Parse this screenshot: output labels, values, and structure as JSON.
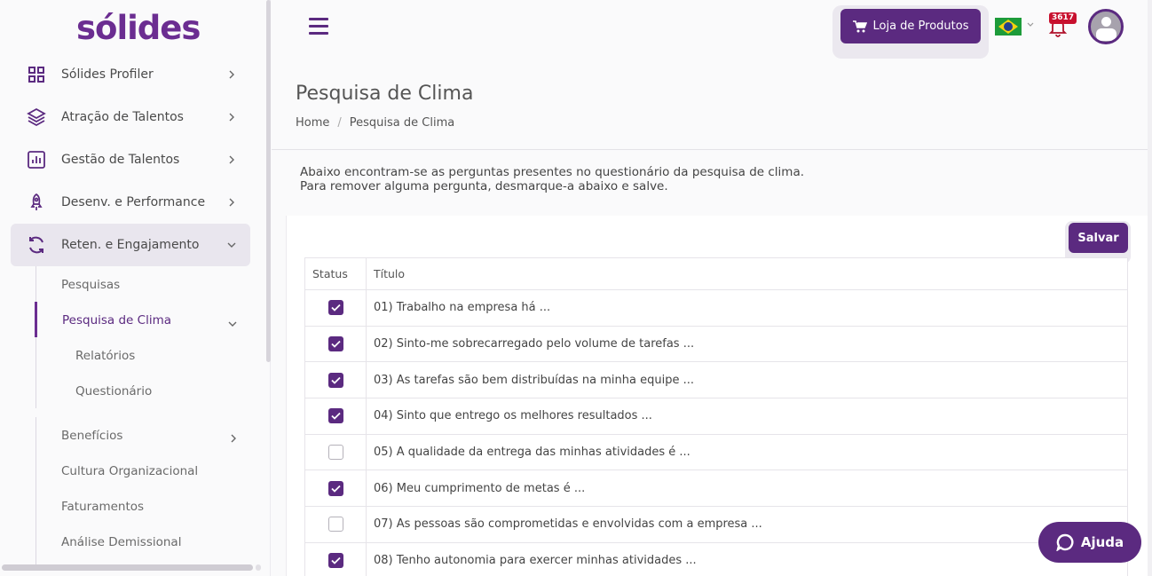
{
  "brand": {
    "logo_text": "sólides",
    "primary_color": "#5b2a80",
    "accent_color": "#6b2d91"
  },
  "sidebar": {
    "items": [
      {
        "label": "Sólides Profiler",
        "icon": "grid-icon"
      },
      {
        "label": "Atração de Talentos",
        "icon": "layers-icon"
      },
      {
        "label": "Gestão de Talentos",
        "icon": "bar-chart-icon"
      },
      {
        "label": "Desenv. e Performance",
        "icon": "rocket-icon"
      },
      {
        "label": "Reten. e Engajamento",
        "icon": "refresh-icon",
        "active": true
      }
    ],
    "subitems": {
      "pesquisas": "Pesquisas",
      "pesquisa_clima": "Pesquisa de Clima",
      "relatorios": "Relatórios",
      "questionario": "Questionário",
      "beneficios": "Benefícios",
      "cultura": "Cultura Organizacional",
      "faturamentos": "Faturamentos",
      "analise": "Análise Demissional"
    }
  },
  "topbar": {
    "shop_label": "Loja de Produtos",
    "notification_count": "3617",
    "language": "pt-BR"
  },
  "page": {
    "title": "Pesquisa de Clima",
    "breadcrumb": {
      "home": "Home",
      "separator": "/",
      "current": "Pesquisa de Clima"
    },
    "intro_line1": "Abaixo encontram-se as perguntas presentes no questionário da pesquisa de clima.",
    "intro_line2": "Para remover alguma pergunta, desmarque-a abaixo e salve.",
    "save_label": "Salvar"
  },
  "table": {
    "headers": {
      "status": "Status",
      "title": "Título"
    },
    "rows": [
      {
        "checked": true,
        "title": "01) Trabalho na empresa há ..."
      },
      {
        "checked": true,
        "title": "02) Sinto-me sobrecarregado pelo volume de tarefas ..."
      },
      {
        "checked": true,
        "title": "03) As tarefas são bem distribuídas na minha equipe ..."
      },
      {
        "checked": true,
        "title": "04) Sinto que entrego os melhores resultados ..."
      },
      {
        "checked": false,
        "title": "05) A qualidade da entrega das minhas atividades é ..."
      },
      {
        "checked": true,
        "title": "06) Meu cumprimento de metas é ..."
      },
      {
        "checked": false,
        "title": "07) As pessoas são comprometidas e envolvidas com a empresa ..."
      },
      {
        "checked": true,
        "title": "08) Tenho autonomia para exercer minhas atividades ..."
      }
    ]
  },
  "help": {
    "label": "Ajuda"
  }
}
